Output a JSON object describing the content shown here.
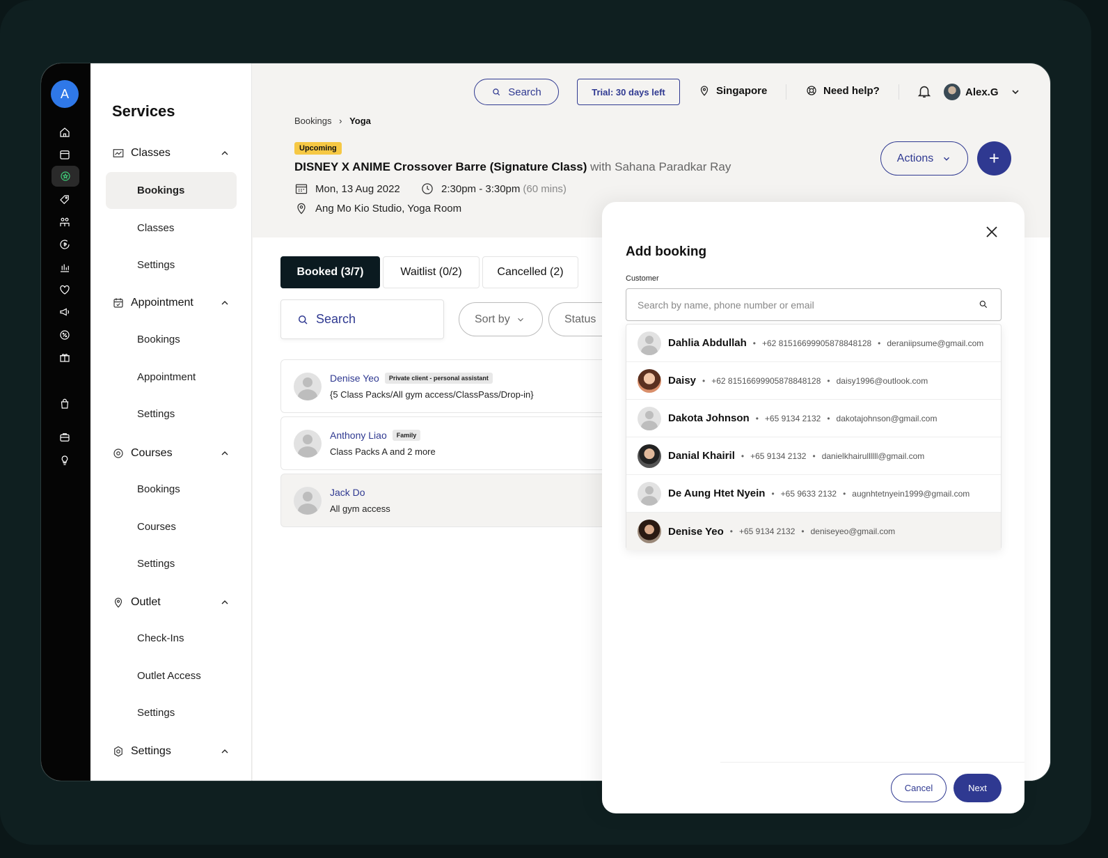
{
  "rail": {
    "avatar_letter": "A"
  },
  "sidebar": {
    "title": "Services",
    "sections": [
      {
        "label": "Classes",
        "items": [
          "Bookings",
          "Classes",
          "Settings"
        ]
      },
      {
        "label": "Appointment",
        "items": [
          "Bookings",
          "Appointment",
          "Settings"
        ]
      },
      {
        "label": "Courses",
        "items": [
          "Bookings",
          "Courses",
          "Settings"
        ]
      },
      {
        "label": "Outlet",
        "items": [
          "Check-Ins",
          "Outlet Access",
          "Settings"
        ]
      },
      {
        "label": "Settings",
        "items": []
      }
    ]
  },
  "topbar": {
    "search_label": "Search",
    "trial_label": "Trial: 30 days left",
    "location": "Singapore",
    "help": "Need help?",
    "user": "Alex.G"
  },
  "breadcrumb": {
    "parent": "Bookings",
    "sep": "›",
    "current": "Yoga"
  },
  "class_info": {
    "status": "Upcoming",
    "title": "DISNEY X ANIME Crossover Barre (Signature Class)",
    "instructor": "with Sahana Paradkar Ray",
    "date": "Mon, 13 Aug 2022",
    "time": "2:30pm - 3:30pm",
    "duration": "(60 mins)",
    "location": "Ang Mo Kio Studio, Yoga Room"
  },
  "header_actions": {
    "actions_label": "Actions",
    "plus_label": "+"
  },
  "tabs": [
    "Booked (3/7)",
    "Waitlist (0/2)",
    "Cancelled (2)"
  ],
  "filters": {
    "search_label": "Search",
    "sort_label": "Sort by",
    "status_label": "Status"
  },
  "bookings": [
    {
      "name": "Denise Yeo",
      "tag": "Private client - personal assistant",
      "sub": "{5 Class Packs/All gym access/ClassPass/Drop-in}"
    },
    {
      "name": "Anthony Liao",
      "tag": "Family",
      "sub": "Class Packs A and 2 more"
    },
    {
      "name": "Jack Do",
      "tag": "",
      "sub": "All gym access"
    }
  ],
  "modal": {
    "title": "Add booking",
    "customer_label": "Customer",
    "search_placeholder": "Search by name, phone number or email",
    "cancel_label": "Cancel",
    "next_label": "Next",
    "customers": [
      {
        "name": "Dahlia Abdullah",
        "phone": "+62 8151669990587884812​8",
        "email": "deraniipsume@gmail.com"
      },
      {
        "name": "Daisy",
        "phone": "+62 81516699905878848128",
        "email": "daisy1996@outlook.com"
      },
      {
        "name": "Dakota Johnson",
        "phone": "+65 9134 2132",
        "email": "dakotajohnson@gmail.com"
      },
      {
        "name": "Danial Khairil",
        "phone": "+65 9134 2132",
        "email": "danielkhairullllll@gmail.com"
      },
      {
        "name": "De Aung Htet Nyein",
        "phone": "+65 9633 2132",
        "email": "augnhtetnyein1999@gmail.com"
      },
      {
        "name": "Denise Yeo",
        "phone": "+65 9134 2132",
        "email": "deniseyeo@gmail.com"
      }
    ]
  },
  "colors": {
    "brand": "#2f3991",
    "active_green": "#3fd07a",
    "upcoming": "#f6c844"
  }
}
